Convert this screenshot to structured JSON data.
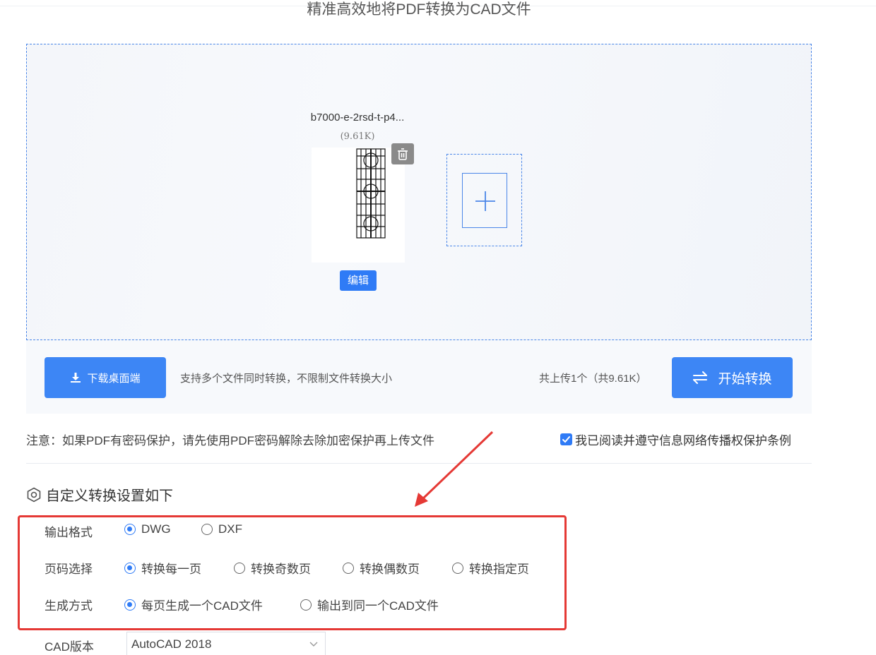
{
  "header": {
    "subtitle": "精准高效地将PDF转换为CAD文件"
  },
  "upload": {
    "file_name": "b7000-e-2rsd-t-p4...",
    "file_size": "(9.61K)",
    "edit_label": "编辑"
  },
  "actions": {
    "download_label": "下载桌面端",
    "support_text": "支持多个文件同时转换，不限制文件转换大小",
    "upload_count": "共上传1个（共9.61K）",
    "start_label": "开始转换"
  },
  "notice": "注意：如果PDF有密码保护，请先使用PDF密码解除去除加密保护再上传文件",
  "agreement": {
    "label": "我已阅读并遵守信息网络传播权保护条例",
    "checked": true
  },
  "settings": {
    "title": "自定义转换设置如下",
    "output_format": {
      "label": "输出格式",
      "options": [
        "DWG",
        "DXF"
      ],
      "selected": "DWG"
    },
    "page_select": {
      "label": "页码选择",
      "options": [
        "转换每一页",
        "转换奇数页",
        "转换偶数页",
        "转换指定页"
      ],
      "selected": "转换每一页"
    },
    "generate_mode": {
      "label": "生成方式",
      "options": [
        "每页生成一个CAD文件",
        "输出到同一个CAD文件"
      ],
      "selected": "每页生成一个CAD文件"
    },
    "cad_version": {
      "label": "CAD版本",
      "value": "AutoCAD 2018"
    }
  },
  "colors": {
    "accent": "#2f7bf6",
    "highlight": "#e53935"
  }
}
